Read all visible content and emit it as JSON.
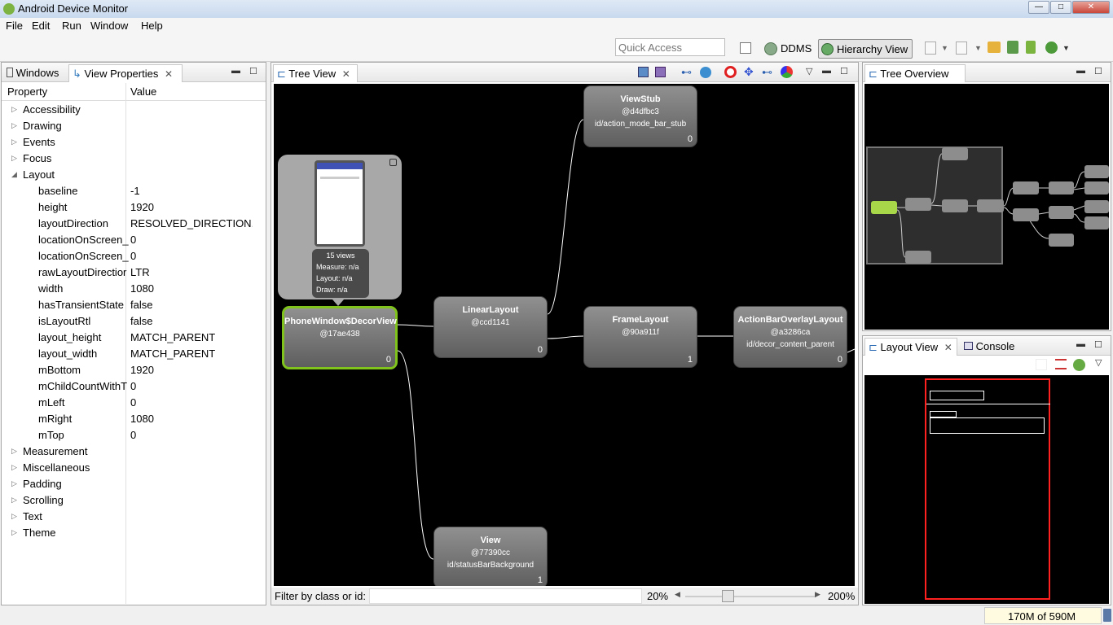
{
  "window": {
    "title": "Android Device Monitor",
    "minimize": "—",
    "maximize": "□",
    "close": "✕"
  },
  "menu": [
    "File",
    "Edit",
    "Run",
    "Window",
    "Help"
  ],
  "toolbar": {
    "quick_access_placeholder": "Quick Access",
    "ddms": "DDMS",
    "hierarchy_view": "Hierarchy View"
  },
  "left_panel": {
    "tabs": [
      "Windows",
      "View Properties"
    ],
    "col_property": "Property",
    "col_value": "Value",
    "rows": [
      {
        "k": "Accessibility",
        "v": "",
        "cat": true,
        "open": false
      },
      {
        "k": "Drawing",
        "v": "",
        "cat": true,
        "open": false
      },
      {
        "k": "Events",
        "v": "",
        "cat": true,
        "open": false
      },
      {
        "k": "Focus",
        "v": "",
        "cat": true,
        "open": false
      },
      {
        "k": "Layout",
        "v": "",
        "cat": true,
        "open": true
      },
      {
        "k": "baseline",
        "v": "-1"
      },
      {
        "k": "height",
        "v": "1920"
      },
      {
        "k": "layoutDirection",
        "v": "RESOLVED_DIRECTION..."
      },
      {
        "k": "locationOnScreen_",
        "v": "0"
      },
      {
        "k": "locationOnScreen_",
        "v": "0"
      },
      {
        "k": "rawLayoutDirectior",
        "v": "LTR"
      },
      {
        "k": "width",
        "v": "1080"
      },
      {
        "k": "hasTransientState",
        "v": "false"
      },
      {
        "k": "isLayoutRtl",
        "v": "false"
      },
      {
        "k": "layout_height",
        "v": "MATCH_PARENT"
      },
      {
        "k": "layout_width",
        "v": "MATCH_PARENT"
      },
      {
        "k": "mBottom",
        "v": "1920"
      },
      {
        "k": "mChildCountWithT",
        "v": "0"
      },
      {
        "k": "mLeft",
        "v": "0"
      },
      {
        "k": "mRight",
        "v": "1080"
      },
      {
        "k": "mTop",
        "v": "0"
      },
      {
        "k": "Measurement",
        "v": "",
        "cat": true,
        "open": false
      },
      {
        "k": "Miscellaneous",
        "v": "",
        "cat": true,
        "open": false
      },
      {
        "k": "Padding",
        "v": "",
        "cat": true,
        "open": false
      },
      {
        "k": "Scrolling",
        "v": "",
        "cat": true,
        "open": false
      },
      {
        "k": "Text",
        "v": "",
        "cat": true,
        "open": false
      },
      {
        "k": "Theme",
        "v": "",
        "cat": true,
        "open": false
      }
    ]
  },
  "tree_view": {
    "tab": "Tree View",
    "filter_label": "Filter by class or id:",
    "zoom_min": "20%",
    "zoom_max": "200%",
    "tooltip": {
      "views": "15 views",
      "measure": "Measure: n/a",
      "layout": "Layout: n/a",
      "draw": "Draw: n/a"
    },
    "nodes": [
      {
        "name": "PhoneWindow$DecorView",
        "hash": "@17ae438",
        "id": "",
        "count": "0"
      },
      {
        "name": "LinearLayout",
        "hash": "@ccd1141",
        "id": "",
        "count": "0"
      },
      {
        "name": "ViewStub",
        "hash": "@d4dfbc3",
        "id": "id/action_mode_bar_stub",
        "count": "0"
      },
      {
        "name": "FrameLayout",
        "hash": "@90a911f",
        "id": "",
        "count": "1"
      },
      {
        "name": "ActionBarOverlayLayout",
        "hash": "@a3286ca",
        "id": "id/decor_content_parent",
        "count": "0"
      },
      {
        "name": "View",
        "hash": "@77390cc",
        "id": "id/statusBarBackground",
        "count": "1"
      }
    ]
  },
  "tree_overview": {
    "tab": "Tree Overview"
  },
  "layout_view": {
    "tabs": [
      "Layout View",
      "Console"
    ]
  },
  "status": {
    "memory": "170M of 590M"
  },
  "colors": {
    "selected_node": "#7fc31c",
    "layout_outline": "#ff2020"
  }
}
